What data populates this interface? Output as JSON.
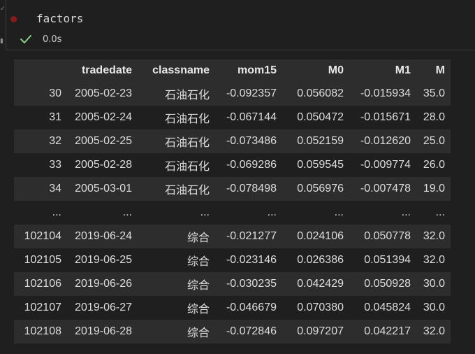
{
  "cell": {
    "code": "factors",
    "status": "0.0s"
  },
  "table": {
    "columns": [
      "",
      "tradedate",
      "classname",
      "mom15",
      "M0",
      "M1",
      "M"
    ],
    "rows": [
      [
        "30",
        "2005-02-23",
        "石油石化",
        "-0.092357",
        "0.056082",
        "-0.015934",
        "35.0"
      ],
      [
        "31",
        "2005-02-24",
        "石油石化",
        "-0.067144",
        "0.050472",
        "-0.015671",
        "28.0"
      ],
      [
        "32",
        "2005-02-25",
        "石油石化",
        "-0.073486",
        "0.052159",
        "-0.012620",
        "25.0"
      ],
      [
        "33",
        "2005-02-28",
        "石油石化",
        "-0.069286",
        "0.059545",
        "-0.009774",
        "26.0"
      ],
      [
        "34",
        "2005-03-01",
        "石油石化",
        "-0.078498",
        "0.056976",
        "-0.007478",
        "19.0"
      ],
      [
        "...",
        "...",
        "...",
        "...",
        "...",
        "...",
        "..."
      ],
      [
        "102104",
        "2019-06-24",
        "综合",
        "-0.021277",
        "0.024106",
        "0.050778",
        "32.0"
      ],
      [
        "102105",
        "2019-06-25",
        "综合",
        "-0.023146",
        "0.026386",
        "0.051394",
        "32.0"
      ],
      [
        "102106",
        "2019-06-26",
        "综合",
        "-0.030235",
        "0.042429",
        "0.050928",
        "30.0"
      ],
      [
        "102107",
        "2019-06-27",
        "综合",
        "-0.046679",
        "0.070380",
        "0.045824",
        "30.0"
      ],
      [
        "102108",
        "2019-06-28",
        "综合",
        "-0.072846",
        "0.097207",
        "0.042217",
        "32.0"
      ]
    ]
  },
  "colors": {
    "background": "#1f1f1f",
    "stripe": "#2d2d2d",
    "run_indicator": "#8b1a1a",
    "success_check": "#89d185"
  },
  "icons": {
    "run_indicator": "record-dot-icon",
    "status": "check-icon"
  }
}
